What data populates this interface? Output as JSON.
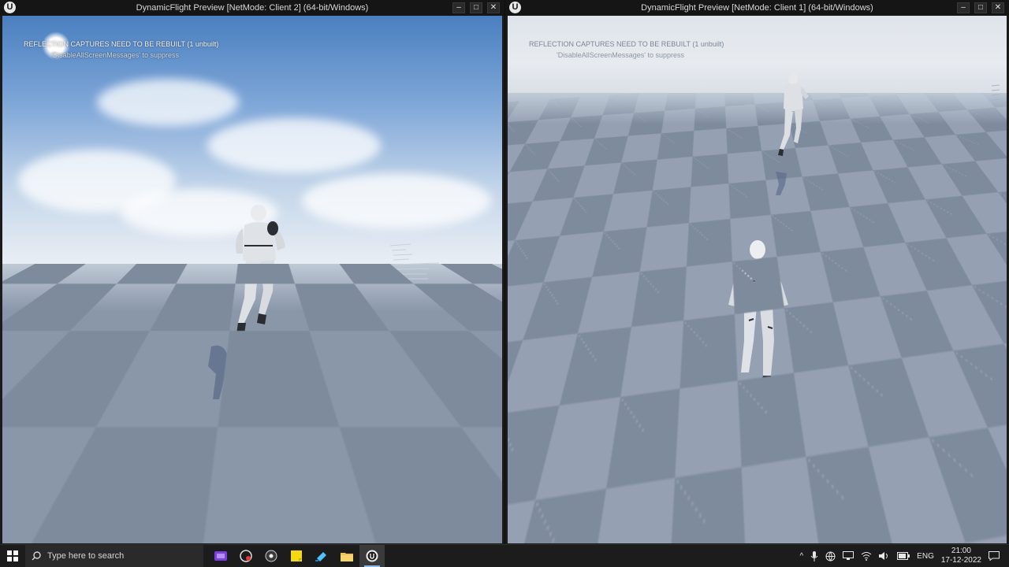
{
  "windows": [
    {
      "title": "DynamicFlight Preview [NetMode: Client 2]  (64-bit/Windows)",
      "message": "REFLECTION CAPTURES NEED TO BE REBUILT (1 unbuilt)",
      "message_sub": "'DisableAllScreenMessages' to suppress"
    },
    {
      "title": "DynamicFlight Preview [NetMode: Client 1]  (64-bit/Windows)",
      "message": "REFLECTION CAPTURES NEED TO BE REBUILT (1 unbuilt)",
      "message_sub": "'DisableAllScreenMessages' to suppress"
    }
  ],
  "window_controls": {
    "minimize": "–",
    "maximize": "□",
    "close": "✕"
  },
  "taskbar": {
    "search_placeholder": "Type here to search",
    "apps": [
      "video-editor-icon",
      "screen-recorder-icon",
      "media-player-icon",
      "sticky-notes-icon",
      "app-icon",
      "file-explorer-icon",
      "unreal-engine-icon"
    ],
    "tray": {
      "language": "ENG",
      "time": "21:00",
      "date": "17-12-2022"
    }
  },
  "colors": {
    "sky_top": "#4a7fc0",
    "ground_light": "#95a0b2",
    "ground_dark": "#7e8b9d",
    "titlebar": "#151515",
    "taskbar": "#1c1c1c"
  }
}
